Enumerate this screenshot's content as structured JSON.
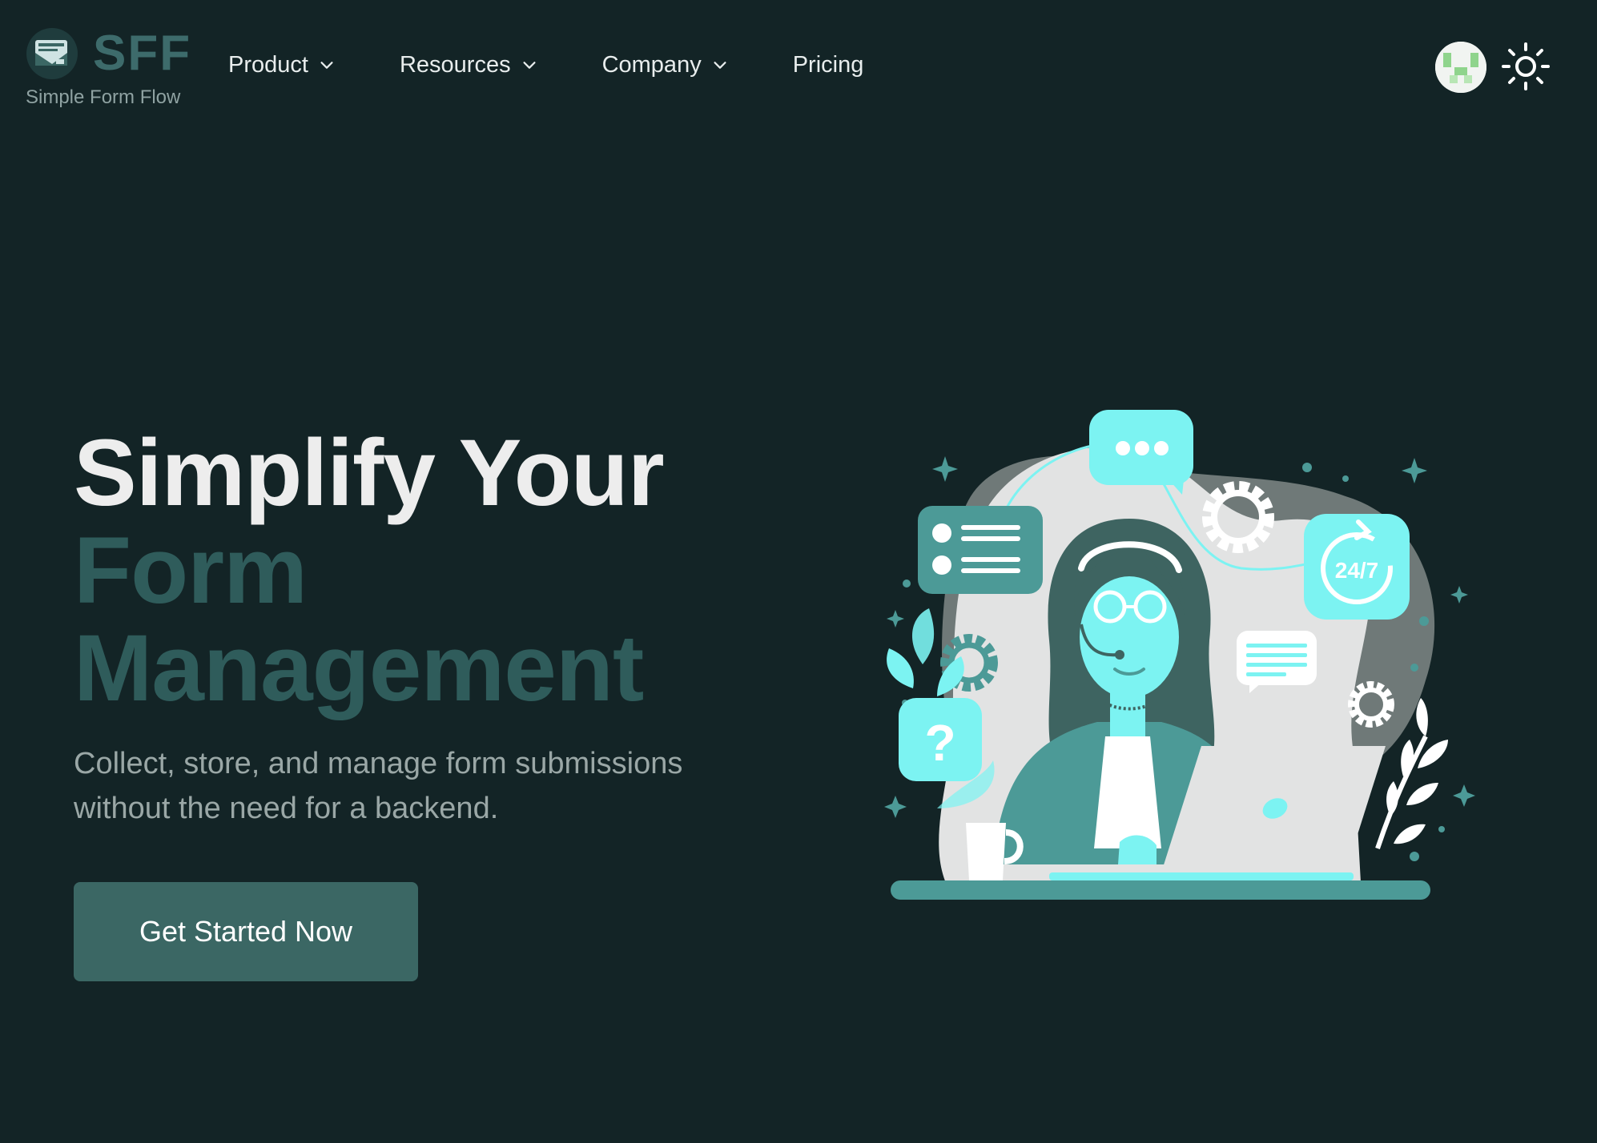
{
  "brand": {
    "name": "SFF",
    "tagline": "Simple Form Flow"
  },
  "nav": {
    "items": [
      {
        "label": "Product",
        "has_dropdown": true
      },
      {
        "label": "Resources",
        "has_dropdown": true
      },
      {
        "label": "Company",
        "has_dropdown": true
      },
      {
        "label": "Pricing",
        "has_dropdown": false
      }
    ],
    "icons": [
      "avatar",
      "sun-icon"
    ]
  },
  "hero": {
    "title_line1": "Simplify Your",
    "title_line2": "Form",
    "title_line3": "Management",
    "subtitle": "Collect, store, and manage form submissions without the need for a backend.",
    "cta_label": "Get Started Now"
  },
  "illustration": {
    "clock_label": "24/7",
    "question_label": "?",
    "icons": [
      "chat-dots-icon",
      "list-icon",
      "gear-icon",
      "clock-24-7-icon",
      "question-icon",
      "message-icon",
      "laptop-icon",
      "coffee-mug-icon",
      "headset-icon"
    ]
  },
  "colors": {
    "background": "#132426",
    "accent_teal": "#3b6764",
    "brand_text": "#3d6b6b",
    "title_muted": "#2f5c5b",
    "cyan": "#7cf3f2"
  }
}
